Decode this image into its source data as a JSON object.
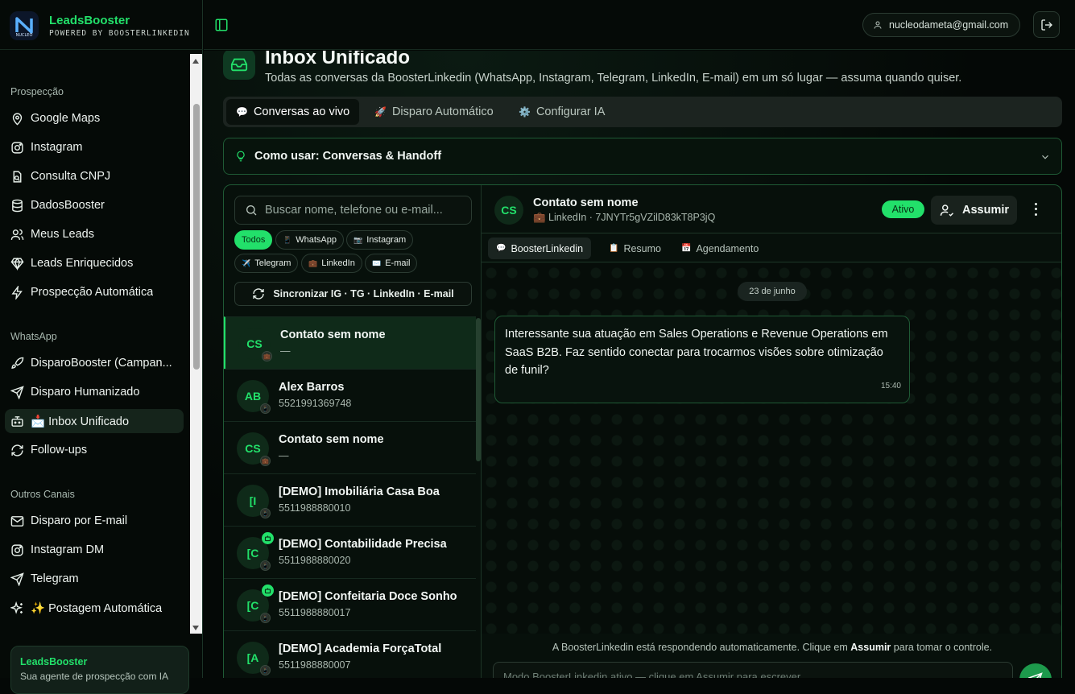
{
  "brand": {
    "name": "LeadsBooster",
    "subtitle": "POWERED BY BOOSTERLINKEDIN",
    "logo_text": "NUCLEO"
  },
  "sidebar": {
    "sections": [
      {
        "title": "Prospecção",
        "items": [
          {
            "label": "Google Maps",
            "icon": "map-pin-icon"
          },
          {
            "label": "Instagram",
            "icon": "instagram-icon"
          },
          {
            "label": "Consulta CNPJ",
            "icon": "file-search-icon"
          },
          {
            "label": "DadosBooster",
            "icon": "database-icon"
          },
          {
            "label": "Meus Leads",
            "icon": "users-icon"
          },
          {
            "label": "Leads Enriquecidos",
            "icon": "gem-icon"
          },
          {
            "label": "Prospecção Automática",
            "icon": "zap-icon"
          }
        ]
      },
      {
        "title": "WhatsApp",
        "items": [
          {
            "label": "DisparoBooster (Campan...",
            "icon": "rocket-icon"
          },
          {
            "label": "Disparo Humanizado",
            "icon": "send-icon"
          },
          {
            "label": "📩 Inbox Unificado",
            "icon": "bot-icon",
            "active": true
          },
          {
            "label": "Follow-ups",
            "icon": "refresh-icon"
          }
        ]
      },
      {
        "title": "Outros Canais",
        "items": [
          {
            "label": "Disparo por E-mail",
            "icon": "mail-icon"
          },
          {
            "label": "Instagram DM",
            "icon": "instagram-icon"
          },
          {
            "label": "Telegram",
            "icon": "send-icon"
          },
          {
            "label": "✨ Postagem Automática",
            "icon": "sparkles-icon"
          }
        ]
      }
    ],
    "promo": {
      "title": "LeadsBooster",
      "text": "Sua agente de prospecção com IA"
    }
  },
  "topbar": {
    "user_email": "nucleodameta@gmail.com"
  },
  "page": {
    "title": "Inbox Unificado",
    "subtitle": "Todas as conversas da BoosterLinkedin (WhatsApp, Instagram, Telegram, LinkedIn, E-mail) em um só lugar — assuma quando quiser.",
    "tabs": [
      {
        "emoji": "💬",
        "label": "Conversas ao vivo",
        "active": true
      },
      {
        "emoji": "🚀",
        "label": "Disparo Automático"
      },
      {
        "emoji": "⚙️",
        "label": "Configurar IA"
      }
    ],
    "howto": "Como usar: Conversas & Handoff"
  },
  "inbox": {
    "search_placeholder": "Buscar nome, telefone ou e-mail...",
    "filters": [
      {
        "label": "Todos",
        "emoji": "",
        "active": true
      },
      {
        "label": "WhatsApp",
        "emoji": "📱"
      },
      {
        "label": "Instagram",
        "emoji": "📷"
      },
      {
        "label": "Telegram",
        "emoji": "✈️"
      },
      {
        "label": "LinkedIn",
        "emoji": "💼"
      },
      {
        "label": "E-mail",
        "emoji": "✉️"
      }
    ],
    "sync_label": "Sincronizar IG · TG · LinkedIn · E-mail",
    "conversations": [
      {
        "initials": "CS",
        "name": "Contato sem nome",
        "sub": "—",
        "channel": "💼",
        "active": true
      },
      {
        "initials": "AB",
        "name": "Alex Barros",
        "sub": "5521991369748",
        "channel": "📱"
      },
      {
        "initials": "CS",
        "name": "Contato sem nome",
        "sub": "—",
        "channel": "💼"
      },
      {
        "initials": "[I",
        "name": "[DEMO] Imobiliária Casa Boa",
        "sub": "5511988880010",
        "channel": "📱"
      },
      {
        "initials": "[C",
        "name": "[DEMO] Contabilidade Precisa",
        "sub": "5511988880020",
        "channel": "📱",
        "bot": true
      },
      {
        "initials": "[C",
        "name": "[DEMO] Confeitaria Doce Sonho",
        "sub": "5511988880017",
        "channel": "📱",
        "bot": true
      },
      {
        "initials": "[A",
        "name": "[DEMO] Academia ForçaTotal",
        "sub": "5511988880007",
        "channel": "📱"
      }
    ]
  },
  "chat": {
    "initials": "CS",
    "name": "Contato sem nome",
    "meta": "💼 LinkedIn · 7JNYTr5gVZilD83kT8P3jQ",
    "status": "Ativo",
    "assume_label": "Assumir",
    "subtabs": [
      {
        "emoji": "💬",
        "label": "BoosterLinkedin",
        "active": true
      },
      {
        "emoji": "📋",
        "label": "Resumo"
      },
      {
        "emoji": "📅",
        "label": "Agendamento"
      }
    ],
    "date": "23 de junho",
    "message": {
      "text": "Interessante sua atuação em Sales Operations e Revenue Operations em SaaS B2B. Faz sentido conectar para trocarmos visões sobre otimização de funil?",
      "time": "15:40"
    },
    "notice_pre": "A BoosterLinkedin está respondendo automaticamente. Clique em",
    "notice_bold": "Assumir",
    "notice_post": "para tomar o controle.",
    "composer_placeholder": "Modo BoosterLinkedin ativo — clique em Assumir para escrever"
  },
  "colors": {
    "accent": "#22e06a",
    "background": "#040806",
    "border_accent": "#1f5a35"
  }
}
